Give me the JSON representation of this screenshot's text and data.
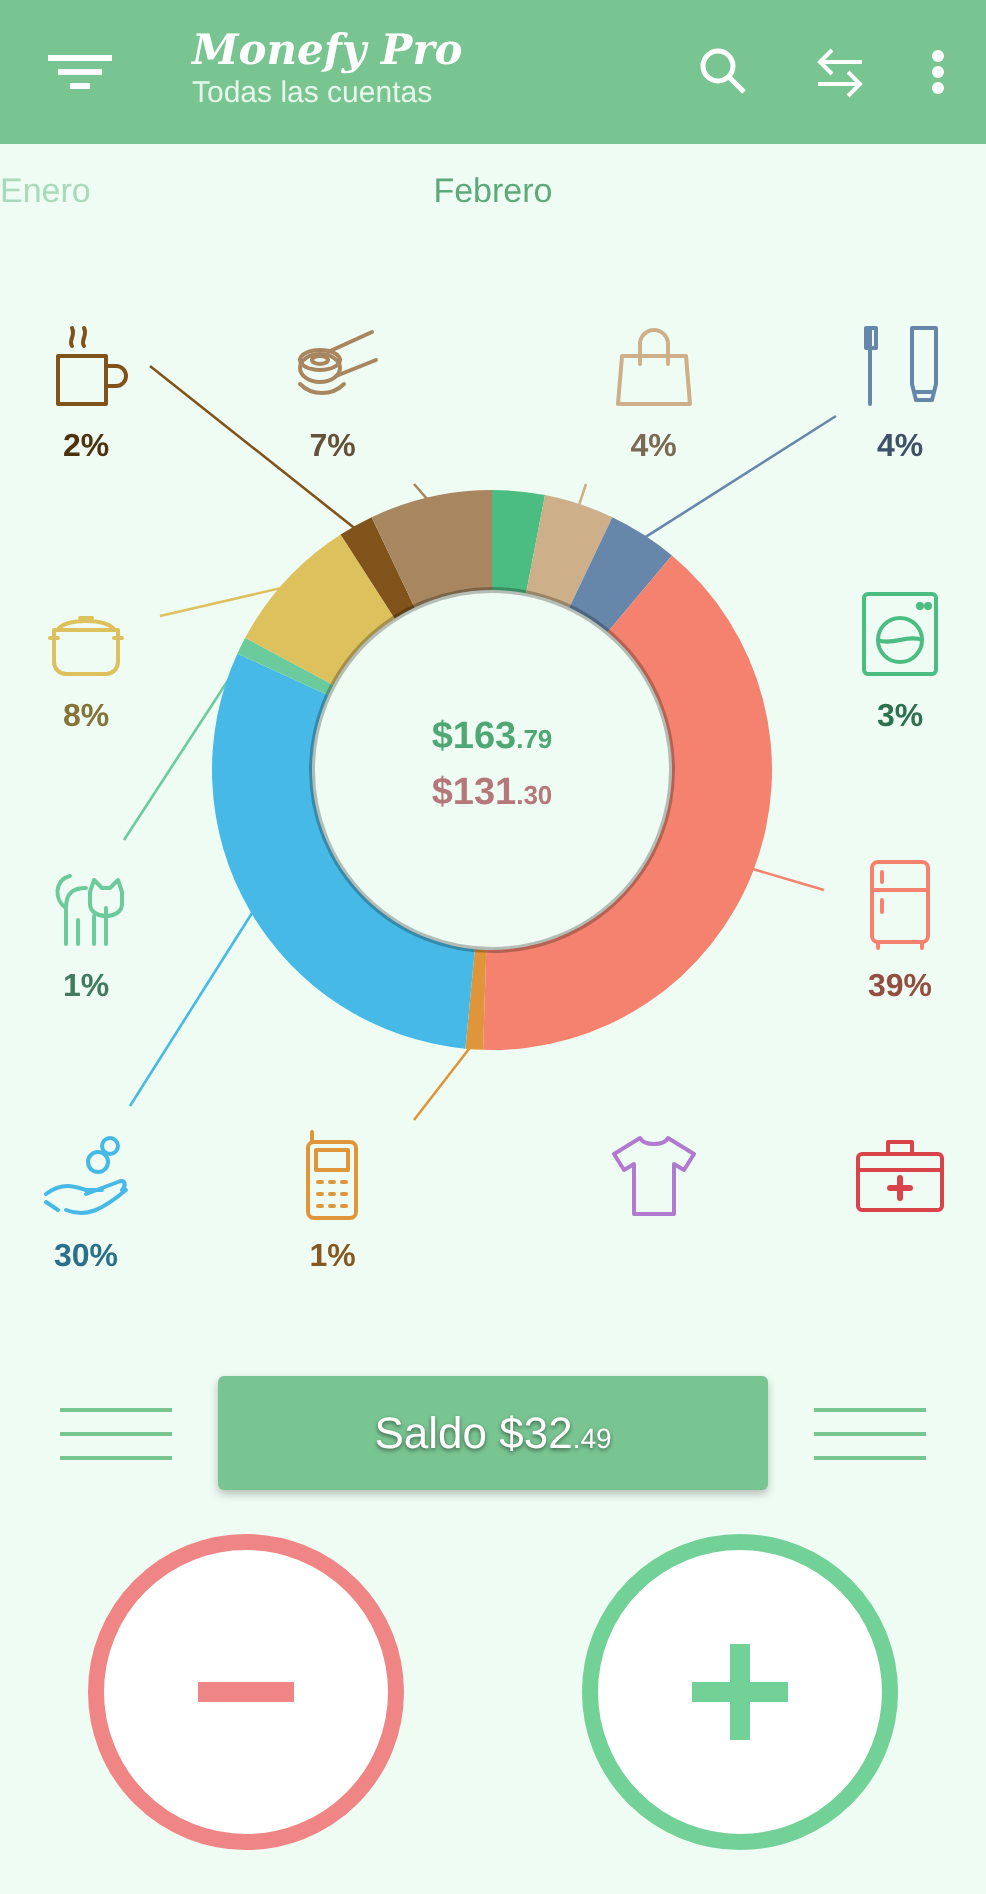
{
  "app_bar": {
    "title": "Monefy Pro",
    "subtitle": "Todas las cuentas"
  },
  "months": [
    {
      "label": "Enero",
      "selected": false
    },
    {
      "label": "Febrero",
      "selected": true
    }
  ],
  "categories": [
    {
      "kind": "coffee",
      "percent": "2%",
      "color": "#80531a"
    },
    {
      "kind": "sushi",
      "percent": "7%",
      "color": "#a8865f"
    },
    {
      "kind": "bag",
      "percent": "4%",
      "color": "#cdb08a"
    },
    {
      "kind": "toiletries",
      "percent": "4%",
      "color": "#6787aa"
    },
    {
      "kind": "pot",
      "percent": "8%",
      "color": "#dcc15c"
    },
    {
      "kind": "washer",
      "percent": "3%",
      "color": "#4cbd82"
    },
    {
      "kind": "cat",
      "percent": "1%",
      "color": "#6ccb9c"
    },
    {
      "kind": "fridge",
      "percent": "39%",
      "color": "#f5826e"
    },
    {
      "kind": "hand",
      "percent": "30%",
      "color": "#47b9e6"
    },
    {
      "kind": "phone",
      "percent": "1%",
      "color": "#e0953a"
    },
    {
      "kind": "shirt",
      "color": "#b07ad0"
    },
    {
      "kind": "medkit",
      "color": "#d9434a"
    }
  ],
  "summary": {
    "income": {
      "amount": "$163",
      "cents": ".79"
    },
    "expense": {
      "amount": "$131",
      "cents": ".30"
    },
    "chart_data": {
      "type": "donut",
      "values": [
        3,
        4,
        4,
        39,
        1,
        30,
        1,
        8,
        2,
        7
      ]
    }
  },
  "balance": {
    "label": "Saldo $32",
    "cents": ".49"
  },
  "actions": [
    {
      "kind": "expense"
    },
    {
      "kind": "income"
    }
  ]
}
